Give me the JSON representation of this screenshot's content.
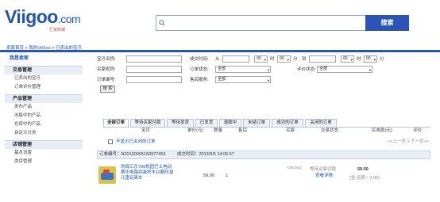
{
  "logo": {
    "main": "Viigoo",
    "suffix": ".com",
    "sub": "汇贸商城"
  },
  "search": {
    "button_label": "搜索",
    "placeholder": ""
  },
  "breadcrumb": "卖家首页 > 我的ViiGoo > 已卖出的宝贝",
  "sidebar": {
    "header": "我是卖家",
    "sections": [
      {
        "title": "交易管理",
        "items": [
          "已卖出的宝贝",
          "订单评价管理"
        ]
      },
      {
        "title": "产品管理",
        "items": [
          "发布产品",
          "出售中的产品",
          "仓库中的产品",
          "自定义分类"
        ]
      },
      {
        "title": "店铺管理",
        "items": [
          "基本设置",
          "类目管理"
        ]
      }
    ]
  },
  "form": {
    "product_name_label": "宝贝名称:",
    "buyer_label": "买家昵称:",
    "order_no_label": "订单编号:",
    "deal_time_label": "成交时间:",
    "from_label": "从",
    "to_label": "到",
    "hour": "时",
    "minute": "分",
    "hour_value": "00",
    "minute_value": "00",
    "order_status_label": "订单状态:",
    "order_status_value": "全部",
    "refund_label": "售后服务:",
    "refund_value": "全部",
    "review_status_label": "评价状态:",
    "review_status_value": "全部",
    "search_btn": "搜 索"
  },
  "tabs": [
    "全部订单",
    "等待买家付款",
    "等待发货",
    "已发货",
    "退款中",
    "未结订单",
    "成功的订单",
    "关闭的订单"
  ],
  "table_headers": [
    "宝贝",
    "单价(元)",
    "数量",
    "售后",
    "买家",
    "交易状态",
    "实收款(元)",
    "评价"
  ],
  "filter": {
    "label": "不显示已关闭的订单",
    "pager": "<<上一页 1 下一页>>"
  },
  "order": {
    "head_no": "订单编号：N20130905100977453",
    "head_time": "成交时间：2013/9/5 14:06:57",
    "title": "凯辉汇乐796校园巴士电动赛乐电路拼装积木10翻乐鼠儿童玩具车",
    "price": "59.00",
    "qty": "1",
    "buyer": "cococo",
    "status": "等待买家付款",
    "detail_link": "查看详情",
    "received": "59.00",
    "shipping": "(含 运费：0.00)"
  }
}
